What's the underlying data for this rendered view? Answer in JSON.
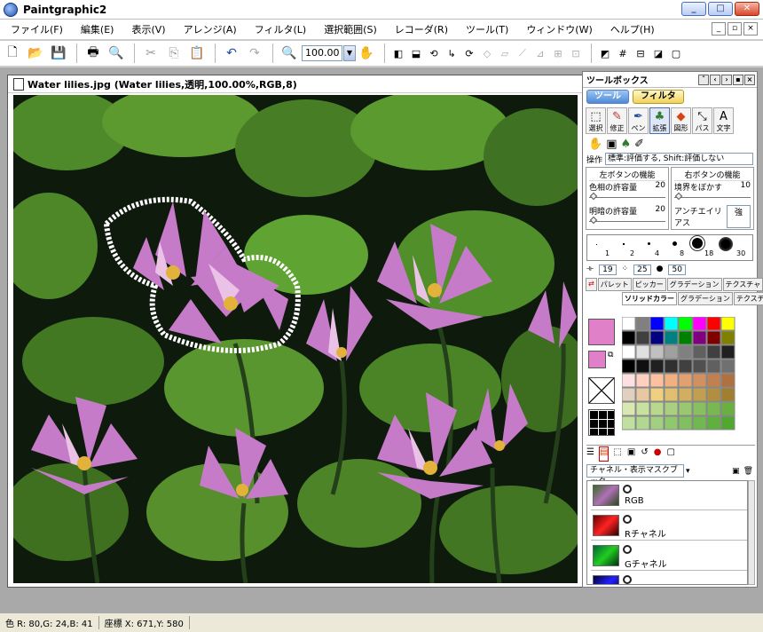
{
  "window": {
    "title": "Paintgraphic2"
  },
  "menu": [
    "ファイル(F)",
    "編集(E)",
    "表示(V)",
    "アレンジ(A)",
    "フィルタ(L)",
    "選択範囲(S)",
    "レコーダ(R)",
    "ツール(T)",
    "ウィンドウ(W)",
    "ヘルプ(H)"
  ],
  "toolbar": {
    "zoom_value": "100.00"
  },
  "document": {
    "title": "Water lilies.jpg (Water lilies,透明,100.00%,RGB,8)"
  },
  "toolbox": {
    "title": "ツールボックス",
    "tabs": [
      "ツール",
      "フィルタ"
    ],
    "tools": [
      {
        "label": "選択",
        "icon": "select-icon"
      },
      {
        "label": "修正",
        "icon": "retouch-icon"
      },
      {
        "label": "ペン",
        "icon": "pen-icon"
      },
      {
        "label": "拡張",
        "icon": "extend-icon"
      },
      {
        "label": "図形",
        "icon": "shape-icon"
      },
      {
        "label": "パス",
        "icon": "path-icon"
      },
      {
        "label": "文字",
        "icon": "text-icon"
      }
    ],
    "operation_label": "操作",
    "operation_value": "標準:評価する, Shift:評価しない",
    "left_group": {
      "title": "左ボタンの機能",
      "color_tol_label": "色相の許容量",
      "color_tol_value": "20",
      "bright_tol_label": "明暗の許容量",
      "bright_tol_value": "20"
    },
    "right_group": {
      "title": "右ボタンの機能",
      "blur_label": "境界をぼかす",
      "blur_value": "10",
      "antialias_label": "アンチエイリアス",
      "antialias_value": "強"
    },
    "brush_sizes": [
      "1",
      "2",
      "4",
      "8",
      "18",
      "30"
    ],
    "brush_params": {
      "size": "19",
      "density": "25",
      "hardness": "50"
    },
    "palette_tabs": [
      "パレット",
      "ピッカー",
      "グラデーション",
      "テクスチャ"
    ],
    "palette_subtabs": [
      "ソリッドカラー",
      "グラデーション",
      "テクスチャ"
    ],
    "channels_dropdown": "チャネル・表示マスクブック",
    "channels": [
      "RGB",
      "Rチャネル",
      "Gチャネル"
    ]
  },
  "status": {
    "color": "色 R: 80,G: 24,B: 41",
    "coords": "座標 X: 671,Y: 580"
  },
  "colors": {
    "accent": "#4f8ad6",
    "foreground": "#e080c8",
    "background": "#e080c8"
  }
}
